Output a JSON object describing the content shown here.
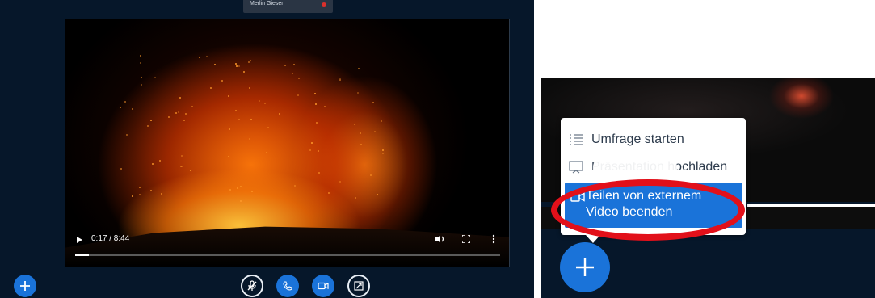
{
  "left_view": {
    "presenter_name": "Merlin Giesen",
    "video": {
      "time_display": "0:17 / 8:44",
      "progress_fraction": 0.0325
    }
  },
  "right_view": {
    "menu": {
      "items": [
        {
          "label": "Umfrage starten",
          "icon": "poll-list-icon"
        },
        {
          "label": "Präsentation hochladen",
          "icon": "presentation-icon"
        },
        {
          "label": "Teilen von externem Video beenden",
          "icon": "video-camera-icon"
        }
      ]
    },
    "highlight_color": "#e2101a"
  },
  "colors": {
    "primary_blue": "#1a73d9",
    "dark_bg": "#06172a"
  }
}
